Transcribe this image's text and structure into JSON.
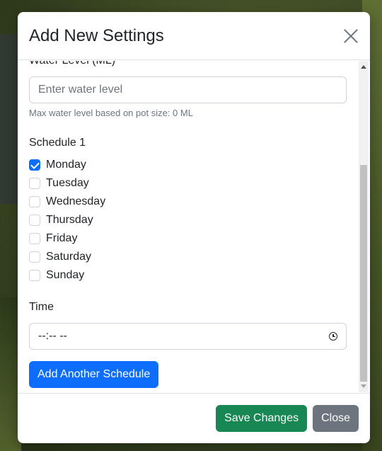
{
  "modal": {
    "title": "Add New Settings"
  },
  "water": {
    "label": "Water Level (ML)",
    "placeholder": "Enter water level",
    "help": "Max water level based on pot size: 0 ML"
  },
  "schedule": {
    "title": "Schedule 1",
    "days": [
      {
        "label": "Monday",
        "checked": true
      },
      {
        "label": "Tuesday",
        "checked": false
      },
      {
        "label": "Wednesday",
        "checked": false
      },
      {
        "label": "Thursday",
        "checked": false
      },
      {
        "label": "Friday",
        "checked": false
      },
      {
        "label": "Saturday",
        "checked": false
      },
      {
        "label": "Sunday",
        "checked": false
      }
    ],
    "time_label": "Time",
    "time_value": "--:-- --",
    "add_button": "Add Another Schedule"
  },
  "footer": {
    "save_label": "Save Changes",
    "close_label": "Close"
  },
  "colors": {
    "primary": "#0d6efd",
    "success": "#198754",
    "secondary": "#6c757d"
  },
  "icons": {
    "close": "close-icon",
    "clock": "clock-icon"
  }
}
